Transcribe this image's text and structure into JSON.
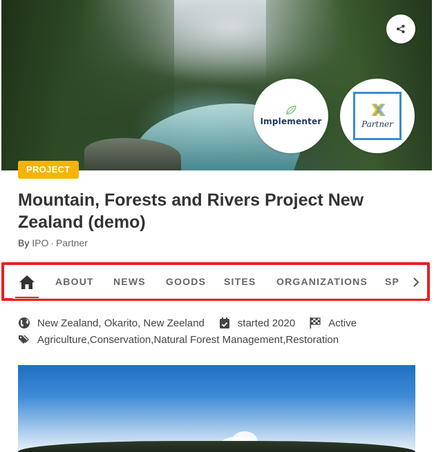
{
  "hero": {
    "implementer_logo_text": "Implementer",
    "partner_logo_text": "Partner",
    "share_icon": "share-icon"
  },
  "project": {
    "tag": "PROJECT",
    "title": "Mountain, Forests and Rivers Project New Zealand (demo)",
    "by_label": "By",
    "org": "IPO",
    "separator": "·",
    "role": "Partner"
  },
  "tabs": {
    "home_icon": "home-icon",
    "items": [
      "ABOUT",
      "NEWS",
      "GOODS",
      "SITES",
      "ORGANIZATIONS",
      "SP"
    ],
    "next_icon": "chevron-right-icon",
    "highlight_color": "#ee1c1c"
  },
  "meta": {
    "location": "New Zealand, Okarito, New Zeeland",
    "started": "started 2020",
    "status": "Active",
    "tags": [
      "Agriculture",
      "Conservation",
      "Natural Forest Management",
      "Restoration"
    ]
  },
  "colors": {
    "accent": "#f5b400",
    "text": "#333333"
  }
}
